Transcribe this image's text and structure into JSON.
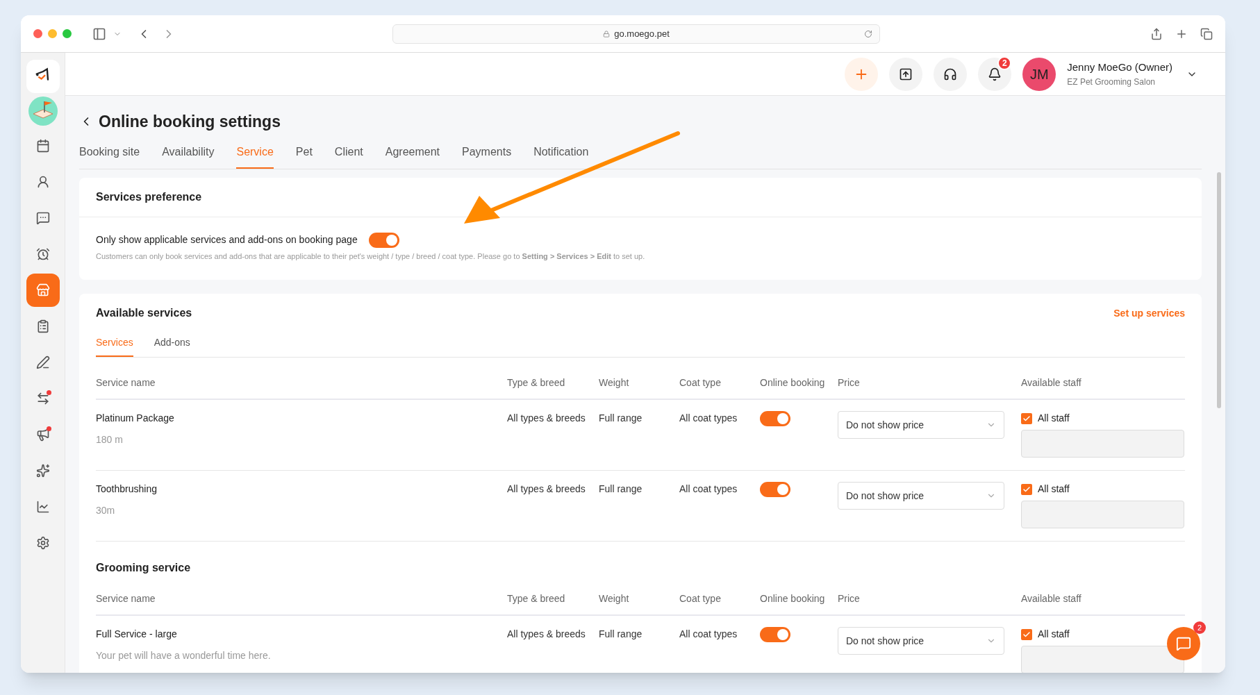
{
  "browser": {
    "url": "go.moego.pet"
  },
  "sidebar": {
    "items": [
      {
        "kind": "logo",
        "selected": false,
        "dot": false
      },
      {
        "kind": "business",
        "selected": false,
        "dot": false
      },
      {
        "kind": "calendar",
        "selected": false,
        "dot": false
      },
      {
        "kind": "clients",
        "selected": false,
        "dot": false
      },
      {
        "kind": "messages",
        "selected": false,
        "dot": false
      },
      {
        "kind": "reminders",
        "selected": false,
        "dot": false
      },
      {
        "kind": "booking",
        "selected": true,
        "dot": false
      },
      {
        "kind": "checklist",
        "selected": false,
        "dot": false
      },
      {
        "kind": "edit",
        "selected": false,
        "dot": false
      },
      {
        "kind": "swap",
        "selected": false,
        "dot": true
      },
      {
        "kind": "marketing",
        "selected": false,
        "dot": true
      },
      {
        "kind": "reviews",
        "selected": false,
        "dot": false
      },
      {
        "kind": "reports",
        "selected": false,
        "dot": false
      },
      {
        "kind": "settings",
        "selected": false,
        "dot": false
      }
    ]
  },
  "header": {
    "notification_count": "2",
    "avatar_initials": "JM",
    "user_name": "Jenny MoeGo (Owner)",
    "business": "EZ Pet Grooming Salon"
  },
  "page": {
    "title": "Online booking settings",
    "tabs": [
      {
        "label": "Booking site",
        "selected": false
      },
      {
        "label": "Availability",
        "selected": false
      },
      {
        "label": "Service",
        "selected": true
      },
      {
        "label": "Pet",
        "selected": false
      },
      {
        "label": "Client",
        "selected": false
      },
      {
        "label": "Agreement",
        "selected": false
      },
      {
        "label": "Payments",
        "selected": false
      },
      {
        "label": "Notification",
        "selected": false
      }
    ]
  },
  "services_preference": {
    "title": "Services preference",
    "option": {
      "label": "Only show applicable services and add-ons on booking page",
      "on": true,
      "description": "Customers can only book services and add-ons that are applicable to their pet's weight / type / breed / coat type. Please go to **Setting > Services > Edit** to set up."
    }
  },
  "available_services": {
    "title": "Available services",
    "link": "Set up services",
    "tabs": [
      {
        "label": "Services",
        "selected": true
      },
      {
        "label": "Add-ons",
        "selected": false
      }
    ],
    "groups": [
      {
        "columns": [
          "Service name",
          "Type & breed",
          "Weight",
          "Coat type",
          "Online booking",
          "Price",
          "Available staff"
        ],
        "rows": [
          {
            "name": "Platinum Package",
            "detail": "180 m",
            "type_breed": "All types & breeds",
            "weight": "Full range",
            "coat_type": "All coat types",
            "online_booking": true,
            "price": "Do not show price",
            "all_staff": {
              "label": "All staff",
              "checked": true
            }
          },
          {
            "name": "Toothbrushing",
            "detail": "30m",
            "type_breed": "All types & breeds",
            "weight": "Full range",
            "coat_type": "All coat types",
            "online_booking": true,
            "price": "Do not show price",
            "all_staff": {
              "label": "All staff",
              "checked": true
            }
          }
        ]
      },
      {
        "heading": "Grooming service",
        "columns": [
          "Service name",
          "Type & breed",
          "Weight",
          "Coat type",
          "Online booking",
          "Price",
          "Available staff"
        ],
        "rows": [
          {
            "name": "Full Service - large",
            "detail": "Your pet will have a wonderful time here.",
            "type_breed": "All types & breeds",
            "weight": "Full range",
            "coat_type": "All coat types",
            "online_booking": true,
            "price": "Do not show price",
            "all_staff": {
              "label": "All staff",
              "checked": true
            }
          }
        ]
      }
    ]
  },
  "chat": {
    "badge": "2"
  }
}
